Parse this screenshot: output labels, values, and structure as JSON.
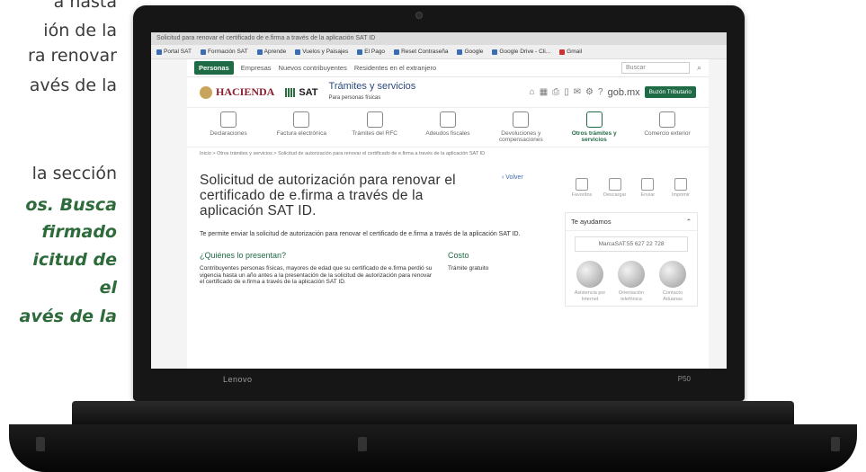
{
  "document": {
    "lines": [
      "a hasta",
      "ión de la",
      "ra renovar",
      "avés de la",
      "la sección",
      "os. Busca",
      "firmado",
      "icitud de",
      "el",
      "avés de la"
    ]
  },
  "laptop": {
    "brand": "Lenovo",
    "model": "P50"
  },
  "browser": {
    "title": "Solicitud para renovar el certificado de e.firma a través de la aplicación SAT ID",
    "bookmarks": [
      "Portal SAT",
      "Formación SAT",
      "Aprende",
      "Vuelos y Paisajes",
      "El Pago",
      "Reset Contraseña",
      "Google",
      "Google Drive - Cli...",
      "Gmail"
    ]
  },
  "site": {
    "nav": {
      "personas": "Personas",
      "empresas": "Empresas",
      "nuevos": "Nuevos contribuyentes",
      "residentes": "Residentes en el extranjero",
      "search_placeholder": "Buscar"
    },
    "header": {
      "hacienda": "HACIENDA",
      "sat": "SAT",
      "tramites_title": "Trámites y servicios",
      "tramites_sub": "Para personas físicas",
      "gob": "gob.mx",
      "buzon": "Buzón Tributario"
    },
    "categories": [
      {
        "label": "Declaraciones"
      },
      {
        "label": "Factura electrónica"
      },
      {
        "label": "Trámites del RFC"
      },
      {
        "label": "Adeudos fiscales"
      },
      {
        "label": "Devoluciones y compensaciones"
      },
      {
        "label": "Otros trámites y servicios"
      },
      {
        "label": "Comercio exterior"
      }
    ],
    "breadcrumb": "Inicio > Otros trámites y servicios > Solicitud de autorización para renovar el certificado de e.firma a través de la aplicación SAT ID",
    "main": {
      "title": "Solicitud de autorización para renovar el certificado de e.firma a través de la aplicación SAT ID.",
      "volver": "‹ Volver",
      "description": "Te permite enviar la solicitud de autorización para renovar el certificado de e.firma a través de la aplicación SAT ID.",
      "quienes_title": "¿Quiénes lo presentan?",
      "quienes_body": "Contribuyentes personas físicas, mayores de edad que su certificado de e.firma perdió su vigencia hasta un año antes a la presentación de la solicitud de autorización para renovar el certificado de e.firma a través de la aplicación SAT ID.",
      "costo_title": "Costo",
      "costo_body": "Trámite gratuito"
    },
    "side": {
      "actions": [
        "Favoritos",
        "Descargar",
        "Enviar",
        "Imprimir"
      ],
      "help_title": "Te ayudamos",
      "phone": "MarcaSAT:55 627 22 728",
      "channels": [
        "Asistencia por Internet",
        "Orientación telefónica",
        "Contacto Aduanas"
      ]
    }
  }
}
